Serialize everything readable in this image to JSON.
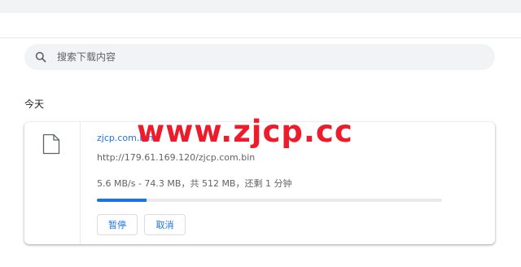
{
  "search": {
    "placeholder": "搜索下载内容"
  },
  "section": {
    "title": "今天"
  },
  "download": {
    "file_name": "zjcp.com.bin",
    "url": "http://179.61.169.120/zjcp.com.bin",
    "status": "5.6 MB/s - 74.3 MB，共 512 MB，还剩 1 分钟",
    "progress_fraction": 0.145,
    "file_icon": "file-icon",
    "pause_label": "暂停",
    "cancel_label": "取消"
  },
  "watermark": {
    "text": "www.zjcp.cc"
  },
  "colors": {
    "accent": "#1a73e8",
    "watermark": "#ee1c2a",
    "search_background": "#f1f3f4"
  }
}
